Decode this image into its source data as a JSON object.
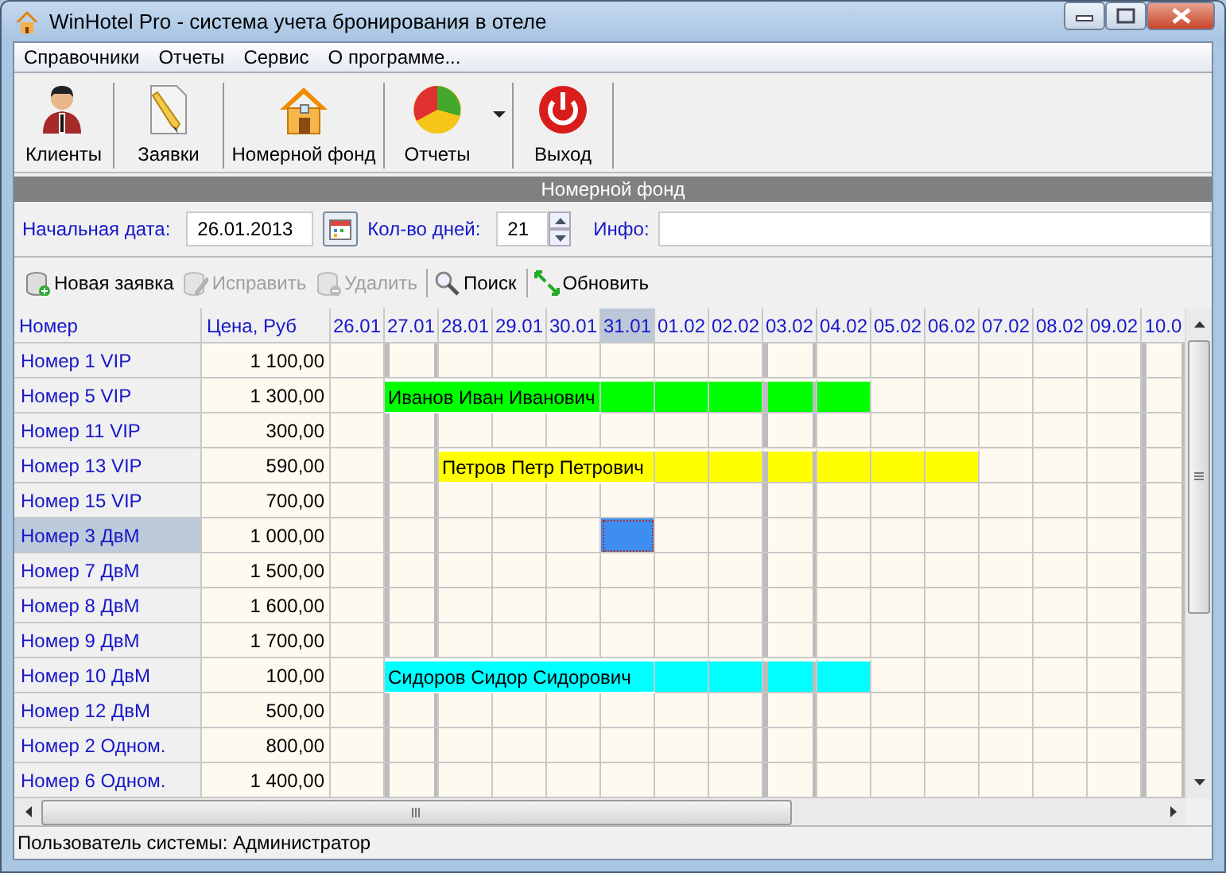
{
  "window": {
    "title": "WinHotel Pro - система учета бронирования в отеле"
  },
  "menu": [
    "Справочники",
    "Отчеты",
    "Сервис",
    "О программе..."
  ],
  "toolbar": [
    {
      "label": "Клиенты",
      "kind": "clients",
      "dropdown": false
    },
    {
      "label": "Заявки",
      "kind": "orders",
      "dropdown": false
    },
    {
      "label": "Номерной фонд",
      "kind": "rooms",
      "dropdown": false
    },
    {
      "label": "Отчеты",
      "kind": "reports",
      "dropdown": true
    },
    {
      "label": "Выход",
      "kind": "exit",
      "dropdown": false
    }
  ],
  "panel_title": "Номерной фонд",
  "filters": {
    "start_label": "Начальная дата:",
    "start_value": "26.01.2013",
    "days_label": "Кол-во дней:",
    "days_value": "21",
    "info_label": "Инфо:"
  },
  "action_groups": [
    [
      {
        "label": "Новая заявка",
        "kind": "new",
        "disabled": false
      },
      {
        "label": "Исправить",
        "kind": "edit",
        "disabled": true
      },
      {
        "label": "Удалить",
        "kind": "delete",
        "disabled": true
      }
    ],
    [
      {
        "label": "Поиск",
        "kind": "search",
        "disabled": false
      }
    ],
    [
      {
        "label": "Обновить",
        "kind": "refresh",
        "disabled": false
      }
    ]
  ],
  "grid": {
    "columns": [
      "Номер",
      "Цена, Руб"
    ],
    "dates": [
      {
        "label": "26.01",
        "selected": false,
        "weekend": false
      },
      {
        "label": "27.01",
        "selected": false,
        "weekend": true
      },
      {
        "label": "28.01",
        "selected": false,
        "weekend": false
      },
      {
        "label": "29.01",
        "selected": false,
        "weekend": false
      },
      {
        "label": "30.01",
        "selected": false,
        "weekend": false
      },
      {
        "label": "31.01",
        "selected": true,
        "weekend": false
      },
      {
        "label": "01.02",
        "selected": false,
        "weekend": false
      },
      {
        "label": "02.02",
        "selected": false,
        "weekend": false
      },
      {
        "label": "03.02",
        "selected": false,
        "weekend": true
      },
      {
        "label": "04.02",
        "selected": false,
        "weekend": false
      },
      {
        "label": "05.02",
        "selected": false,
        "weekend": false
      },
      {
        "label": "06.02",
        "selected": false,
        "weekend": false
      },
      {
        "label": "07.02",
        "selected": false,
        "weekend": false
      },
      {
        "label": "08.02",
        "selected": false,
        "weekend": false
      },
      {
        "label": "09.02",
        "selected": false,
        "weekend": false
      },
      {
        "label": "10.0",
        "selected": false,
        "weekend": true
      }
    ],
    "rows": [
      {
        "room": "Номер 1 VIP",
        "price": "1 100,00",
        "selected": false
      },
      {
        "room": "Номер 5 VIP",
        "price": "1 300,00",
        "selected": false,
        "booking": {
          "guest": "Иванов Иван Иванович",
          "color": "#00ff00",
          "booked": [
            false,
            true,
            true,
            true,
            true,
            true,
            true,
            true,
            true,
            true,
            false,
            false,
            false,
            false,
            false,
            false
          ]
        }
      },
      {
        "room": "Номер 11 VIP",
        "price": "300,00",
        "selected": false
      },
      {
        "room": "Номер 13 VIP",
        "price": "590,00",
        "selected": false,
        "booking": {
          "guest": "Петров Петр Петрович",
          "color": "#ffff00",
          "booked": [
            false,
            false,
            true,
            true,
            true,
            true,
            true,
            true,
            true,
            true,
            true,
            true,
            false,
            false,
            false,
            false
          ]
        }
      },
      {
        "room": "Номер 15 VIP",
        "price": "700,00",
        "selected": false
      },
      {
        "room": "Номер 3 ДвМ",
        "price": "1 000,00",
        "selected": true
      },
      {
        "room": "Номер 7 ДвМ",
        "price": "1 500,00",
        "selected": false
      },
      {
        "room": "Номер 8 ДвМ",
        "price": "1 600,00",
        "selected": false
      },
      {
        "room": "Номер 9 ДвМ",
        "price": "1 700,00",
        "selected": false
      },
      {
        "room": "Номер 10 ДвМ",
        "price": "100,00",
        "selected": false,
        "booking": {
          "guest": "Сидоров Сидор Сидорович",
          "color": "#00ffff",
          "booked": [
            false,
            true,
            true,
            true,
            true,
            true,
            true,
            true,
            true,
            true,
            false,
            false,
            false,
            false,
            false,
            false
          ]
        }
      },
      {
        "room": "Номер 12 ДвМ",
        "price": "500,00",
        "selected": false
      },
      {
        "room": "Номер 2 Одном.",
        "price": "800,00",
        "selected": false
      },
      {
        "room": "Номер 6 Одном.",
        "price": "1 400,00",
        "selected": false
      }
    ]
  },
  "status_bar": "Пользователь системы: Администратор"
}
